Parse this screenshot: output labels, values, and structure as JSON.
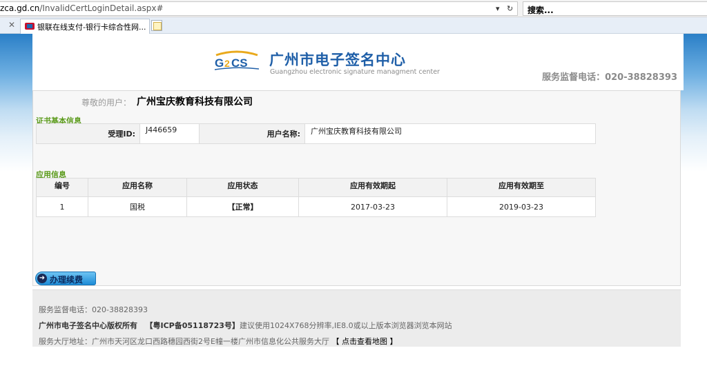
{
  "browser": {
    "url_host": "zca.gd.cn",
    "url_path": "/InvalidCertLoginDetail.aspx#",
    "search_placeholder": "搜索...",
    "tab_title": "银联在线支付-银行卡综合性网...",
    "new_tab_icon": "new-tab-icon"
  },
  "header": {
    "logo_title": "广州市电子签名中心",
    "logo_subtitle": "Guangzhou electronic signature managment center",
    "phone": "服务监督电话：020-38828393"
  },
  "user": {
    "greeting_label": "尊敬的用户：",
    "name": "广州宝庆教育科技有限公司"
  },
  "cert_info": {
    "section_title": "证书基本信息",
    "accept_id_label": "受理ID:",
    "accept_id_value": "J446659",
    "username_label": "用户名称:",
    "username_value": "广州宝庆教育科技有限公司"
  },
  "apps": {
    "section_title": "应用信息",
    "headers": [
      "编号",
      "应用名称",
      "应用状态",
      "应用有效期起",
      "应用有效期至"
    ],
    "rows": [
      [
        "1",
        "国税",
        "【正常】",
        "2017-03-23",
        "2019-03-23"
      ]
    ]
  },
  "actions": {
    "renew_label": "办理续费"
  },
  "footer": {
    "phone": "服务监督电话：020-38828393",
    "copyright": "广州市电子签名中心版权所有",
    "icp": "【粤ICP备05118723号】",
    "browser_note": "建议使用1024X768分辨率,IE8.0或以上版本浏览器浏览本网站",
    "address": "服务大厅地址：广州市天河区龙口西路穗园西街2号E幢一楼广州市信息化公共服务大厅",
    "map_link": "【 点击查看地图 】"
  },
  "colors": {
    "brand_blue": "#1f5fa8",
    "section_green": "#5a9a1a",
    "button_blue": "#1d8bd6"
  }
}
